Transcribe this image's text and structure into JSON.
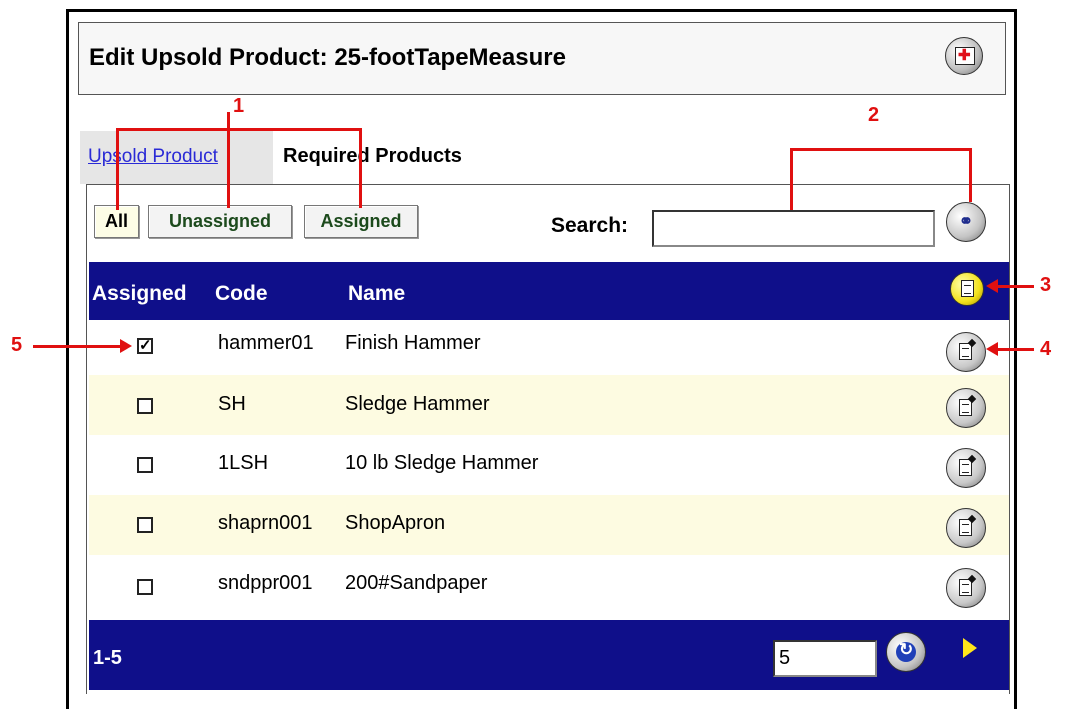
{
  "window": {
    "title": "Edit Upsold Product: 25-footTapeMeasure",
    "close_icon": "close-window-icon"
  },
  "tabs": [
    {
      "label": "Upsold Product",
      "link": true
    },
    {
      "label": "Required Products",
      "active": true
    }
  ],
  "filters": {
    "all": "All",
    "unassigned": "Unassigned",
    "assigned": "Assigned"
  },
  "search": {
    "label": "Search:",
    "value": "",
    "button_icon": "binoculars-icon"
  },
  "table": {
    "headers": {
      "assigned": "Assigned",
      "code": "Code",
      "name": "Name"
    },
    "add_icon": "add-document-icon",
    "rows": [
      {
        "assigned": true,
        "code": "hammer01",
        "name": "Finish Hammer"
      },
      {
        "assigned": false,
        "code": "SH",
        "name": "Sledge Hammer"
      },
      {
        "assigned": false,
        "code": "1LSH",
        "name": "10 lb Sledge Hammer"
      },
      {
        "assigned": false,
        "code": "shaprn001",
        "name": "ShopApron"
      },
      {
        "assigned": false,
        "code": "sndppr001",
        "name": "200#Sandpaper"
      }
    ]
  },
  "footer": {
    "range": "1-5",
    "page_size": "5",
    "refresh_icon": "refresh-icon",
    "next_icon": "next-page-icon"
  },
  "annotations": [
    "1",
    "2",
    "3",
    "4",
    "5"
  ],
  "colors": {
    "header_bg": "#0f0f8a",
    "alt_row_bg": "#fdfbe1",
    "annotation": "#e01010",
    "link": "#2a2ad6"
  }
}
